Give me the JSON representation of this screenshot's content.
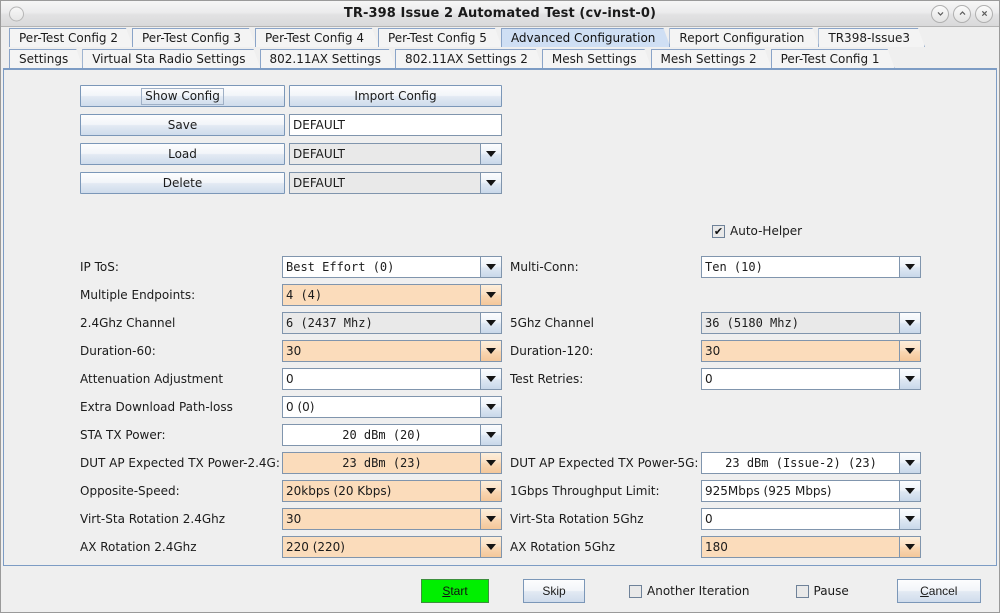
{
  "window": {
    "title": "TR-398 Issue 2 Automated Test  (cv-inst-0)",
    "controls": {
      "minimize": "minimize-icon",
      "maximize": "maximize-icon",
      "close": "close-icon"
    }
  },
  "tabs": {
    "row1": [
      {
        "label": "Per-Test Config 2",
        "active": false
      },
      {
        "label": "Per-Test Config 3",
        "active": false
      },
      {
        "label": "Per-Test Config 4",
        "active": false
      },
      {
        "label": "Per-Test Config 5",
        "active": false
      },
      {
        "label": "Advanced Configuration",
        "active": true
      },
      {
        "label": "Report Configuration",
        "active": false
      },
      {
        "label": "TR398-Issue3",
        "active": false
      }
    ],
    "row2": [
      {
        "label": "Settings",
        "active": false
      },
      {
        "label": "Virtual Sta Radio Settings",
        "active": false
      },
      {
        "label": "802.11AX Settings",
        "active": false
      },
      {
        "label": "802.11AX Settings 2",
        "active": false
      },
      {
        "label": "Mesh Settings",
        "active": false
      },
      {
        "label": "Mesh Settings 2",
        "active": false
      },
      {
        "label": "Per-Test Config 1",
        "active": false
      }
    ]
  },
  "config_block": {
    "show_config": "Show Config",
    "import_config": "Import Config",
    "save": "Save",
    "load": "Load",
    "delete": "Delete",
    "save_name_value": "DEFAULT",
    "load_value": "DEFAULT",
    "delete_value": "DEFAULT"
  },
  "auto_helper": {
    "label": "Auto-Helper",
    "checked": true,
    "check_glyph": "✔"
  },
  "left_fields": [
    {
      "label": "IP ToS:",
      "value": "Best Effort   (0)",
      "style": "white",
      "mono": true
    },
    {
      "label": "Multiple Endpoints:",
      "value": "4 (4)",
      "style": "peach",
      "mono": true
    },
    {
      "label": "2.4Ghz Channel",
      "value": "6 (2437 Mhz)",
      "style": "gray",
      "mono": true
    },
    {
      "label": "Duration-60:",
      "value": "30",
      "style": "peach",
      "mono": false
    },
    {
      "label": "Attenuation Adjustment",
      "value": "0",
      "style": "white",
      "mono": false
    },
    {
      "label": "Extra Download Path-loss",
      "value": "0 (0)",
      "style": "white",
      "mono": false
    },
    {
      "label": "STA TX Power:",
      "value": "20 dBm  (20)",
      "style": "white",
      "mono": true,
      "center": true
    },
    {
      "label": "DUT AP Expected TX Power-2.4G:",
      "value": "23 dBm  (23)",
      "style": "peach",
      "mono": true,
      "center": true
    },
    {
      "label": "Opposite-Speed:",
      "value": "20kbps (20 Kbps)",
      "style": "peach",
      "mono": false
    },
    {
      "label": "Virt-Sta Rotation 2.4Ghz",
      "value": "30",
      "style": "peach",
      "mono": false
    },
    {
      "label": "AX Rotation 2.4Ghz",
      "value": "220 (220)",
      "style": "peach",
      "mono": false
    }
  ],
  "right_fields": [
    {
      "label": "Multi-Conn:",
      "value": "Ten (10)",
      "style": "white",
      "mono": true
    },
    {
      "label": "5Ghz Channel",
      "value": "36 (5180 Mhz)",
      "style": "gray",
      "mono": true
    },
    {
      "label": "Duration-120:",
      "value": "30",
      "style": "peach",
      "mono": false
    },
    {
      "label": "Test Retries:",
      "value": "0",
      "style": "white",
      "mono": false
    },
    {
      "label": "DUT AP Expected TX Power-5G:",
      "value": "23 dBm  (Issue-2)  (23)",
      "style": "white",
      "mono": true,
      "center": true
    },
    {
      "label": "1Gbps Throughput Limit:",
      "value": "925Mbps (925 Mbps)",
      "style": "white",
      "mono": false
    },
    {
      "label": "Virt-Sta Rotation 5Ghz",
      "value": "0",
      "style": "white",
      "mono": false
    },
    {
      "label": "AX Rotation 5Ghz",
      "value": "180",
      "style": "peach",
      "mono": false
    }
  ],
  "footer": {
    "start": "Start",
    "start_accel": "S",
    "skip": "Skip",
    "another_iteration": "Another Iteration",
    "another_iteration_checked": false,
    "pause": "Pause",
    "pause_checked": false,
    "cancel": "Cancel",
    "cancel_accel": "C"
  },
  "colors": {
    "accent": "#7d9cc4",
    "active_tab": "#cfdff4",
    "modified_field": "#fbdcbb",
    "readonly_field": "#e9e9e9",
    "start_green": "#00ef00"
  }
}
